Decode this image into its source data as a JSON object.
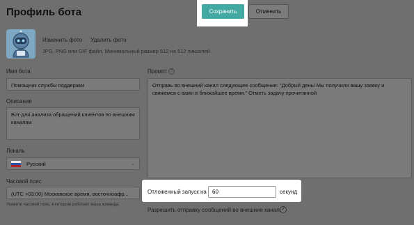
{
  "header": {
    "title": "Профиль бота",
    "save_label": "Сохранить",
    "cancel_label": "Отменить"
  },
  "avatar": {
    "change_label": "Изменить фото",
    "delete_label": "Удалить фото",
    "hint": "JPG, PNG или GIF файл. Минимальный размер 512 на 512 пикселей."
  },
  "form": {
    "name_label": "Имя бота",
    "name_value": "Помощник службы поддержки",
    "description_label": "Описание",
    "description_value": "Бот для анализа обращений клиентов по внешним каналам",
    "locale_label": "Локаль",
    "locale_value": "Русский",
    "timezone_label": "Часовой пояс",
    "timezone_value": "(UTC +03:00) Московское время, восточноафр...",
    "timezone_hint": "Укажите часовой пояс, в котором работает ваша команда.",
    "prompt_label": "Промпт",
    "prompt_value": "Отправь во внешний канал следующее сообщение: \"Добрый день! Мы получили вашу заявку и свяжемся с вами в ближайшее время.\" Отметь задачу прочитанной",
    "delay_label": "Отложенный запуск на",
    "delay_value": "60",
    "delay_unit": "секунд",
    "allow_external_label": "Разрешить отправку сообщений во внешние каналы"
  }
}
